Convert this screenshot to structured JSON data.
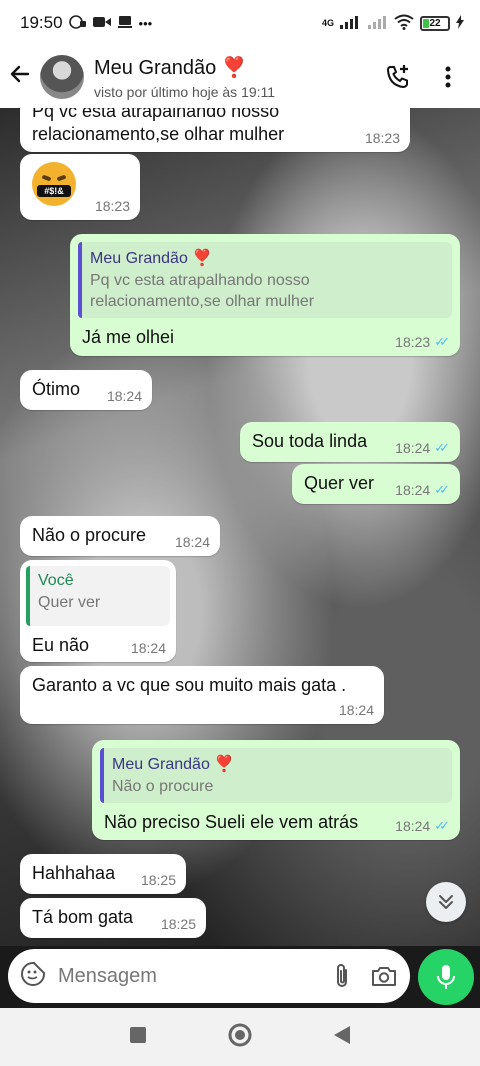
{
  "status_bar": {
    "time": "19:50",
    "battery": "22",
    "network": "4G"
  },
  "header": {
    "contact_name": "Meu Grandão ❣️",
    "last_seen": "visto por último hoje às 19:11"
  },
  "messages": [
    {
      "text": "Pq vc esta atrapalhando nosso relacionamento,se olhar  mulher",
      "time": "18:23"
    },
    {
      "emoji_text": "#$!&",
      "time": "18:23"
    },
    {
      "quote_name": "Meu Grandão ❣️",
      "quote_text": "Pq vc esta atrapalhando nosso relacionamento,se olhar  mulher",
      "text": "Já me olhei",
      "time": "18:23"
    },
    {
      "text": "Ótimo",
      "time": "18:24"
    },
    {
      "text": "Sou toda linda",
      "time": "18:24"
    },
    {
      "text": "Quer ver",
      "time": "18:24"
    },
    {
      "text": "Não o procure",
      "time": "18:24"
    },
    {
      "quote_name": "Você",
      "quote_text": "Quer ver",
      "text": "Eu não",
      "time": "18:24"
    },
    {
      "text": "Garanto a vc que sou muito mais gata .",
      "time": "18:24"
    },
    {
      "quote_name": "Meu Grandão ❣️",
      "quote_text": "Não o procure",
      "text": "Não preciso Sueli ele vem atrás",
      "time": "18:24"
    },
    {
      "text": "Hahhahaa",
      "time": "18:25"
    },
    {
      "text": "Tá bom gata",
      "time": "18:25"
    }
  ],
  "composer": {
    "placeholder": "Mensagem"
  },
  "colors": {
    "outgoing": "#d9fdd3",
    "incoming": "#ffffff",
    "accent": "#25d366",
    "read_ticks": "#53bdeb"
  }
}
